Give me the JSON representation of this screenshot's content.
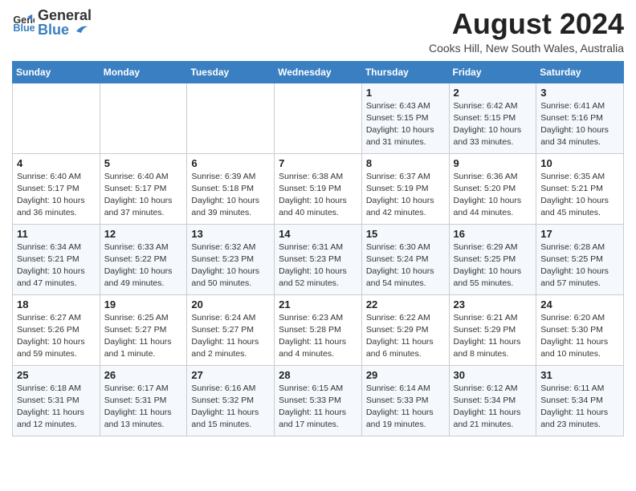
{
  "header": {
    "logo_general": "General",
    "logo_blue": "Blue",
    "month_year": "August 2024",
    "location": "Cooks Hill, New South Wales, Australia"
  },
  "days_of_week": [
    "Sunday",
    "Monday",
    "Tuesday",
    "Wednesday",
    "Thursday",
    "Friday",
    "Saturday"
  ],
  "weeks": [
    [
      {
        "day": "",
        "info": ""
      },
      {
        "day": "",
        "info": ""
      },
      {
        "day": "",
        "info": ""
      },
      {
        "day": "",
        "info": ""
      },
      {
        "day": "1",
        "info": "Sunrise: 6:43 AM\nSunset: 5:15 PM\nDaylight: 10 hours\nand 31 minutes."
      },
      {
        "day": "2",
        "info": "Sunrise: 6:42 AM\nSunset: 5:15 PM\nDaylight: 10 hours\nand 33 minutes."
      },
      {
        "day": "3",
        "info": "Sunrise: 6:41 AM\nSunset: 5:16 PM\nDaylight: 10 hours\nand 34 minutes."
      }
    ],
    [
      {
        "day": "4",
        "info": "Sunrise: 6:40 AM\nSunset: 5:17 PM\nDaylight: 10 hours\nand 36 minutes."
      },
      {
        "day": "5",
        "info": "Sunrise: 6:40 AM\nSunset: 5:17 PM\nDaylight: 10 hours\nand 37 minutes."
      },
      {
        "day": "6",
        "info": "Sunrise: 6:39 AM\nSunset: 5:18 PM\nDaylight: 10 hours\nand 39 minutes."
      },
      {
        "day": "7",
        "info": "Sunrise: 6:38 AM\nSunset: 5:19 PM\nDaylight: 10 hours\nand 40 minutes."
      },
      {
        "day": "8",
        "info": "Sunrise: 6:37 AM\nSunset: 5:19 PM\nDaylight: 10 hours\nand 42 minutes."
      },
      {
        "day": "9",
        "info": "Sunrise: 6:36 AM\nSunset: 5:20 PM\nDaylight: 10 hours\nand 44 minutes."
      },
      {
        "day": "10",
        "info": "Sunrise: 6:35 AM\nSunset: 5:21 PM\nDaylight: 10 hours\nand 45 minutes."
      }
    ],
    [
      {
        "day": "11",
        "info": "Sunrise: 6:34 AM\nSunset: 5:21 PM\nDaylight: 10 hours\nand 47 minutes."
      },
      {
        "day": "12",
        "info": "Sunrise: 6:33 AM\nSunset: 5:22 PM\nDaylight: 10 hours\nand 49 minutes."
      },
      {
        "day": "13",
        "info": "Sunrise: 6:32 AM\nSunset: 5:23 PM\nDaylight: 10 hours\nand 50 minutes."
      },
      {
        "day": "14",
        "info": "Sunrise: 6:31 AM\nSunset: 5:23 PM\nDaylight: 10 hours\nand 52 minutes."
      },
      {
        "day": "15",
        "info": "Sunrise: 6:30 AM\nSunset: 5:24 PM\nDaylight: 10 hours\nand 54 minutes."
      },
      {
        "day": "16",
        "info": "Sunrise: 6:29 AM\nSunset: 5:25 PM\nDaylight: 10 hours\nand 55 minutes."
      },
      {
        "day": "17",
        "info": "Sunrise: 6:28 AM\nSunset: 5:25 PM\nDaylight: 10 hours\nand 57 minutes."
      }
    ],
    [
      {
        "day": "18",
        "info": "Sunrise: 6:27 AM\nSunset: 5:26 PM\nDaylight: 10 hours\nand 59 minutes."
      },
      {
        "day": "19",
        "info": "Sunrise: 6:25 AM\nSunset: 5:27 PM\nDaylight: 11 hours\nand 1 minute."
      },
      {
        "day": "20",
        "info": "Sunrise: 6:24 AM\nSunset: 5:27 PM\nDaylight: 11 hours\nand 2 minutes."
      },
      {
        "day": "21",
        "info": "Sunrise: 6:23 AM\nSunset: 5:28 PM\nDaylight: 11 hours\nand 4 minutes."
      },
      {
        "day": "22",
        "info": "Sunrise: 6:22 AM\nSunset: 5:29 PM\nDaylight: 11 hours\nand 6 minutes."
      },
      {
        "day": "23",
        "info": "Sunrise: 6:21 AM\nSunset: 5:29 PM\nDaylight: 11 hours\nand 8 minutes."
      },
      {
        "day": "24",
        "info": "Sunrise: 6:20 AM\nSunset: 5:30 PM\nDaylight: 11 hours\nand 10 minutes."
      }
    ],
    [
      {
        "day": "25",
        "info": "Sunrise: 6:18 AM\nSunset: 5:31 PM\nDaylight: 11 hours\nand 12 minutes."
      },
      {
        "day": "26",
        "info": "Sunrise: 6:17 AM\nSunset: 5:31 PM\nDaylight: 11 hours\nand 13 minutes."
      },
      {
        "day": "27",
        "info": "Sunrise: 6:16 AM\nSunset: 5:32 PM\nDaylight: 11 hours\nand 15 minutes."
      },
      {
        "day": "28",
        "info": "Sunrise: 6:15 AM\nSunset: 5:33 PM\nDaylight: 11 hours\nand 17 minutes."
      },
      {
        "day": "29",
        "info": "Sunrise: 6:14 AM\nSunset: 5:33 PM\nDaylight: 11 hours\nand 19 minutes."
      },
      {
        "day": "30",
        "info": "Sunrise: 6:12 AM\nSunset: 5:34 PM\nDaylight: 11 hours\nand 21 minutes."
      },
      {
        "day": "31",
        "info": "Sunrise: 6:11 AM\nSunset: 5:34 PM\nDaylight: 11 hours\nand 23 minutes."
      }
    ]
  ]
}
